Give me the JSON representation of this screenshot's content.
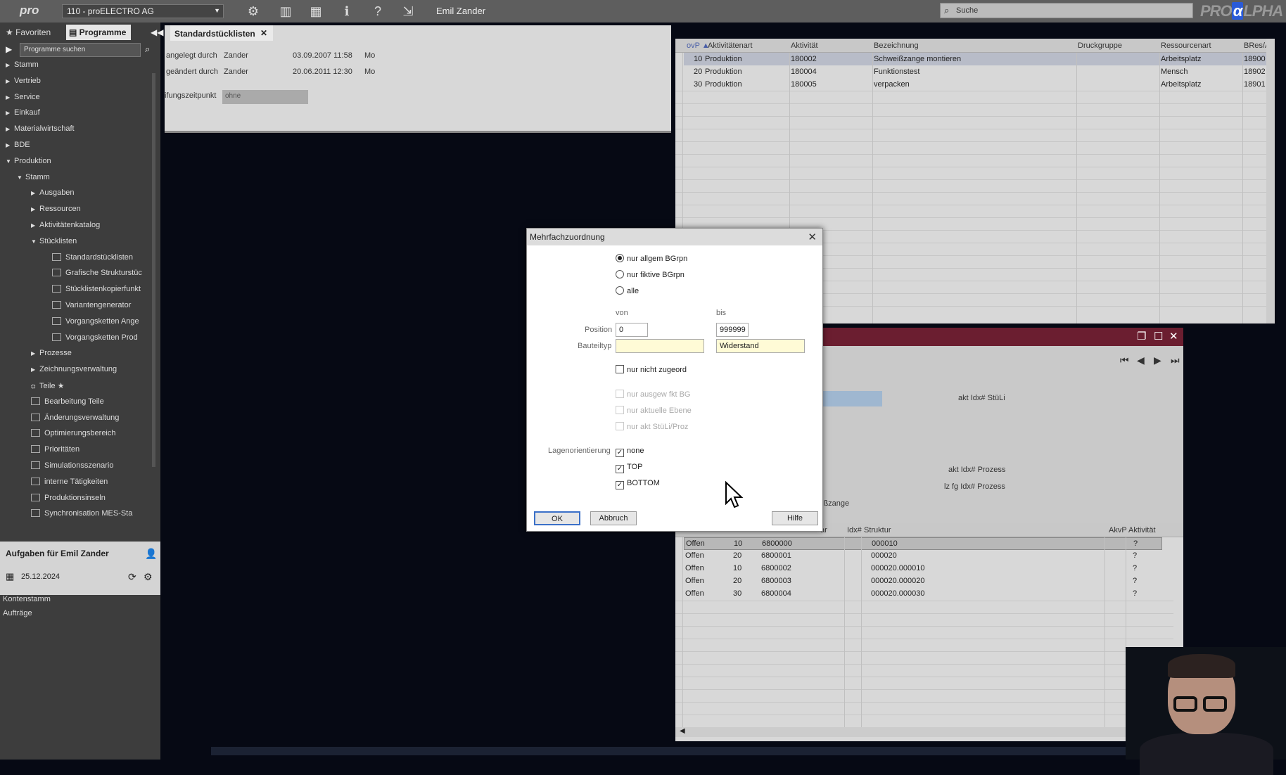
{
  "topbar": {
    "logo_left": "pro",
    "company": "110 - proELECTRO AG",
    "user": "Emil Zander",
    "search_placeholder": "Suche",
    "logo_right": "PRO",
    "logo_right_mark": "α",
    "logo_right_tail": "LPHA",
    "icons": [
      "gear-icon",
      "layout-panel-icon",
      "grid-icon",
      "info-icon",
      "help-icon",
      "logout-icon"
    ]
  },
  "sidebar": {
    "tab_favoriten": "Favoriten",
    "tab_programme": "Programme",
    "search_placeholder": "Programme suchen",
    "tree": [
      {
        "label": "Stamm",
        "level": 0,
        "arrow": "right"
      },
      {
        "label": "Vertrieb",
        "level": 0,
        "arrow": "right"
      },
      {
        "label": "Service",
        "level": 0,
        "arrow": "right"
      },
      {
        "label": "Einkauf",
        "level": 0,
        "arrow": "right"
      },
      {
        "label": "Materialwirtschaft",
        "level": 0,
        "arrow": "right"
      },
      {
        "label": "BDE",
        "level": 0,
        "arrow": "right"
      },
      {
        "label": "Produktion",
        "level": 0,
        "arrow": "down"
      },
      {
        "label": "Stamm",
        "level": 1,
        "arrow": "down"
      },
      {
        "label": "Ausgaben",
        "level": 2,
        "arrow": "right"
      },
      {
        "label": "Ressourcen",
        "level": 2,
        "arrow": "right"
      },
      {
        "label": "Aktivitätenkatalog",
        "level": 2,
        "arrow": "right"
      },
      {
        "label": "Stücklisten",
        "level": 2,
        "arrow": "down"
      },
      {
        "label": "Standardstücklisten",
        "level": 3,
        "arrow": "box"
      },
      {
        "label": "Grafische Strukturstüc",
        "level": 3,
        "arrow": "box"
      },
      {
        "label": "Stücklistenkopierfunkt",
        "level": 3,
        "arrow": "box"
      },
      {
        "label": "Variantengenerator",
        "level": 3,
        "arrow": "box"
      },
      {
        "label": "Vorgangsketten Ange",
        "level": 3,
        "arrow": "box"
      },
      {
        "label": "Vorgangsketten Prod",
        "level": 3,
        "arrow": "box"
      },
      {
        "label": "Prozesse",
        "level": 2,
        "arrow": "right"
      },
      {
        "label": "Zeichnungsverwaltung",
        "level": 2,
        "arrow": "right"
      },
      {
        "label": "Teile ★",
        "level": 2,
        "arrow": "none"
      },
      {
        "label": "Bearbeitung Teile",
        "level": 2,
        "arrow": "box"
      },
      {
        "label": "Änderungsverwaltung",
        "level": 2,
        "arrow": "box"
      },
      {
        "label": "Optimierungsbereich",
        "level": 2,
        "arrow": "box"
      },
      {
        "label": "Prioritäten",
        "level": 2,
        "arrow": "box"
      },
      {
        "label": "Simulationsszenario",
        "level": 2,
        "arrow": "box"
      },
      {
        "label": "interne Tätigkeiten",
        "level": 2,
        "arrow": "box"
      },
      {
        "label": "Produktionsinseln",
        "level": 2,
        "arrow": "box"
      },
      {
        "label": "Synchronisation MES-Sta",
        "level": 2,
        "arrow": "box"
      }
    ],
    "tasks_title": "Aufgaben für Emil Zander",
    "tasks_date": "25.12.2024",
    "task_links": [
      "Kontenstamm",
      "Aufträge"
    ]
  },
  "workarea": {
    "tab": "Standardstücklisten",
    "angelegt_label": "angelegt durch",
    "angelegt_user": "Zander",
    "angelegt_date": "03.09.2007 11:58",
    "angelegt_day": "Mo",
    "geaendert_label": "geändert durch",
    "geaendert_user": "Zander",
    "geaendert_date": "20.06.2011 12:30",
    "geaendert_day": "Mo",
    "zeitpunkt_label": "ifungszeitpunkt",
    "zeitpunkt_value": "ohne"
  },
  "grid1": {
    "headers": [
      "ovP ▲",
      "Aktivitätenart",
      "Aktivität",
      "Bezeichnung",
      "Druckgruppe",
      "Ressourcenart",
      "BRes/A"
    ],
    "rows": [
      [
        "10",
        "Produktion",
        "180002",
        "Schweißzange montieren",
        "",
        "Arbeitsplatz",
        "18900"
      ],
      [
        "20",
        "Produktion",
        "180004",
        "Funktionstest",
        "",
        "Mensch",
        "18902"
      ],
      [
        "30",
        "Produktion",
        "180005",
        "verpacken",
        "",
        "Arbeitsplatz",
        "18901"
      ]
    ]
  },
  "panel2": {
    "lbl_akt_stuli": "akt Idx# StüLi",
    "lbl_akt_prozess": "akt Idx# Prozess",
    "lbl_lz_prozess": "lz fg Idx# Prozess",
    "lbl_zange": "ißzange"
  },
  "grid2": {
    "headers": [
      "ar",
      "Idx#",
      "Struktur",
      "AkvP",
      "Aktivität"
    ],
    "rows": [
      [
        "Offen",
        "10",
        "6800000",
        "000010",
        "?"
      ],
      [
        "Offen",
        "20",
        "6800001",
        "000020",
        "?"
      ],
      [
        "Offen",
        "10",
        "6800002",
        "000020.000010",
        "?"
      ],
      [
        "Offen",
        "20",
        "6800003",
        "000020.000020",
        "?"
      ],
      [
        "Offen",
        "30",
        "6800004",
        "000020.000030",
        "?"
      ]
    ]
  },
  "dialog": {
    "title": "Mehrfachzuordnung",
    "radio1": "nur allgem BGrpn",
    "radio2": "nur fiktive BGrpn",
    "radio3": "alle",
    "von": "von",
    "bis": "bis",
    "position_label": "Position",
    "position_from": "0",
    "position_to": "999999",
    "bauteiltyp_label": "Bauteiltyp",
    "bauteiltyp_from": "",
    "bauteiltyp_to": "Widerstand",
    "cb_nicht_zugeord": "nur nicht zugeord",
    "cb_ausgew": "nur ausgew fkt BG",
    "cb_ebene": "nur aktuelle Ebene",
    "cb_akt": "nur akt StüLi/Proz",
    "lageorientierung_label": "Lagenorientierung",
    "cb_none": "none",
    "cb_top": "TOP",
    "cb_bottom": "BOTTOM",
    "ok": "OK",
    "abbruch": "Abbruch",
    "hilfe": "Hilfe"
  }
}
